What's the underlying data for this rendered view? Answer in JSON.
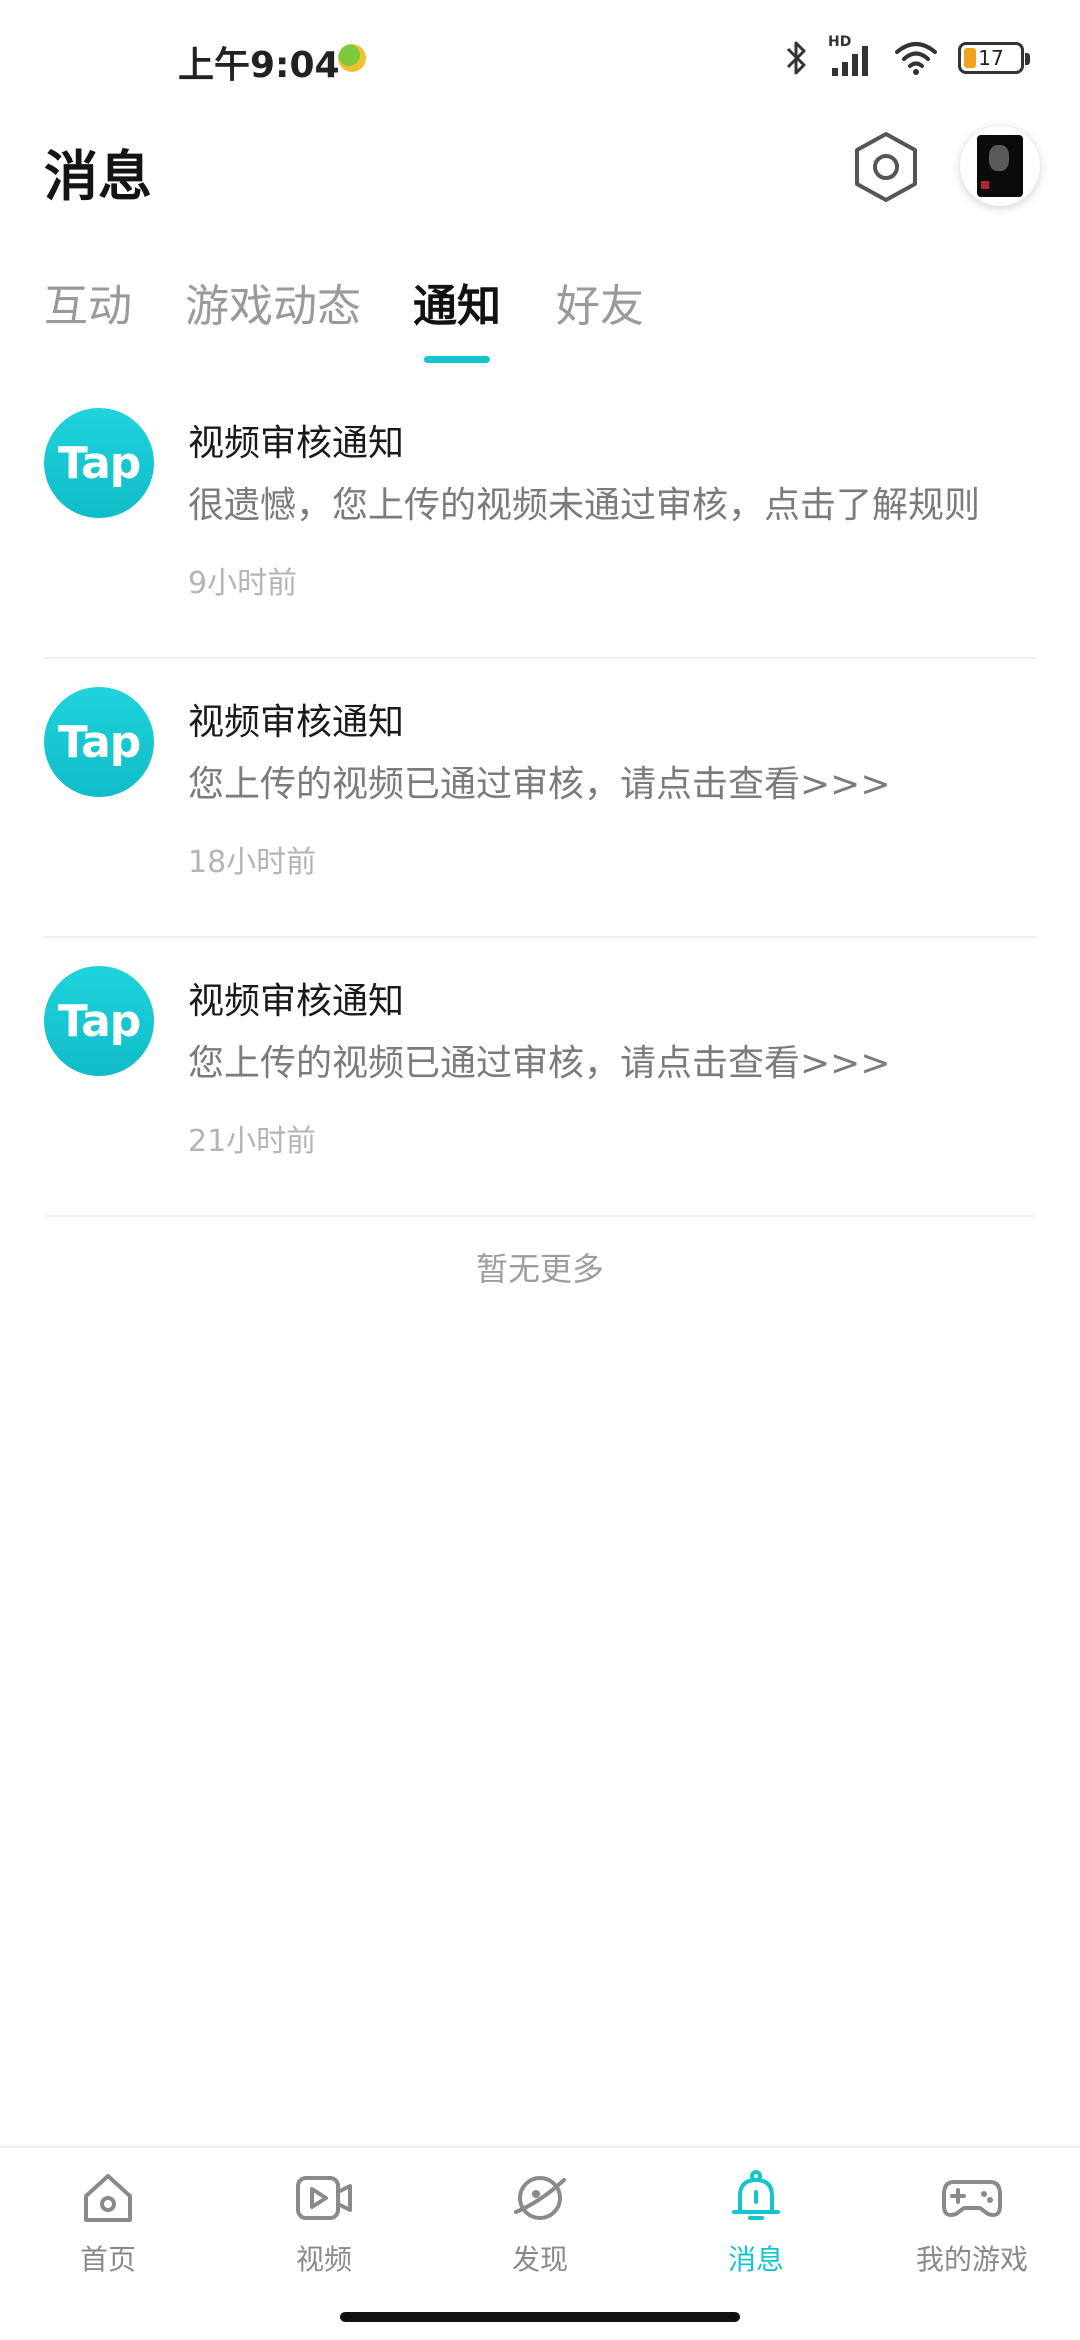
{
  "status_bar": {
    "time": "上午9:04",
    "network_label": "HD",
    "battery_level": "17"
  },
  "header": {
    "title": "消息"
  },
  "tabs": [
    {
      "label": "互动",
      "active": false
    },
    {
      "label": "游戏动态",
      "active": false
    },
    {
      "label": "通知",
      "active": true
    },
    {
      "label": "好友",
      "active": false
    }
  ],
  "notifications": [
    {
      "logo_text": "Tap",
      "title": "视频审核通知",
      "body": "很遗憾，您上传的视频未通过审核，点击了解规则",
      "time": "9小时前"
    },
    {
      "logo_text": "Tap",
      "title": "视频审核通知",
      "body": "您上传的视频已通过审核，请点击查看>>>",
      "time": "18小时前"
    },
    {
      "logo_text": "Tap",
      "title": "视频审核通知",
      "body": "您上传的视频已通过审核，请点击查看>>>",
      "time": "21小时前"
    }
  ],
  "list_footer": "暂无更多",
  "bottom_nav": [
    {
      "label": "首页",
      "icon": "home-icon",
      "active": false
    },
    {
      "label": "视频",
      "icon": "video-icon",
      "active": false
    },
    {
      "label": "发现",
      "icon": "planet-icon",
      "active": false
    },
    {
      "label": "消息",
      "icon": "bell-icon",
      "active": true
    },
    {
      "label": "我的游戏",
      "icon": "gamepad-icon",
      "active": false
    }
  ],
  "colors": {
    "accent": "#15c5ce",
    "battery_fill": "#f0a31d",
    "inactive_text": "#8a8a8a"
  }
}
